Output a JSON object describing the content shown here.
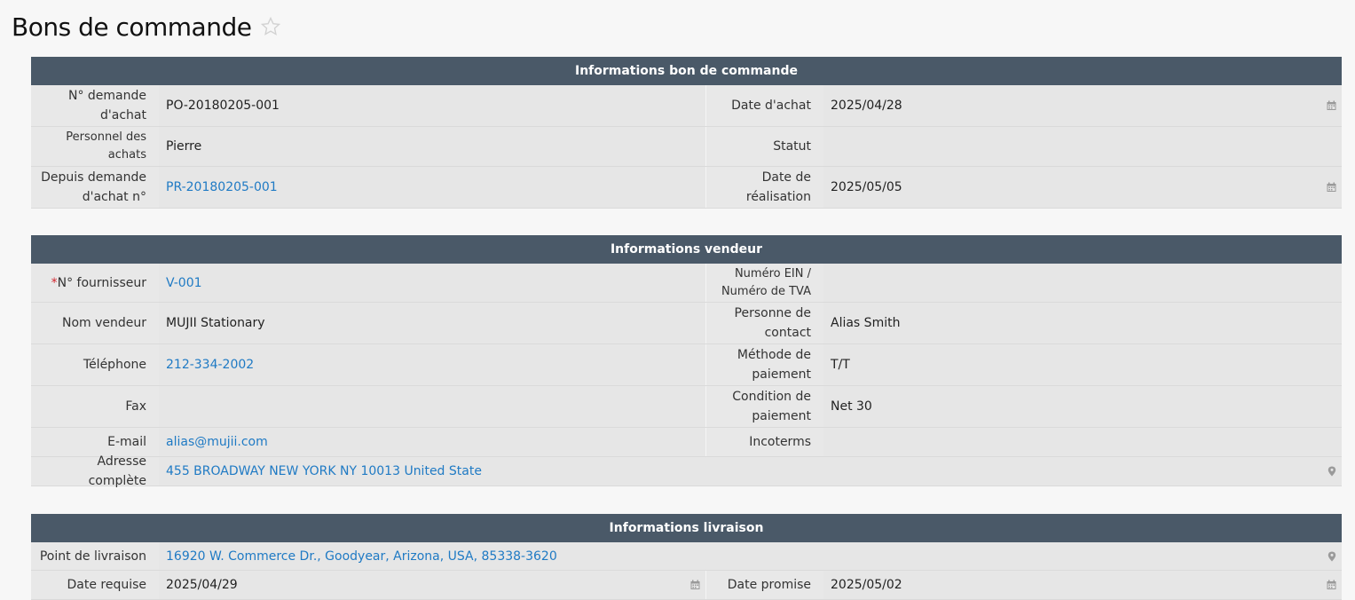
{
  "page": {
    "title": "Bons de commande"
  },
  "po_info": {
    "title": "Informations bon de commande",
    "po_number_label": "N° demande d'achat",
    "po_number": "PO-20180205-001",
    "purchase_date_label": "Date d'achat",
    "purchase_date": "2025/04/28",
    "buyer_label": "Personnel des achats",
    "buyer": "Pierre",
    "status_label": "Statut",
    "status": "",
    "from_pr_label": "Depuis demande d'achat n°",
    "from_pr": "PR-20180205-001",
    "completion_date_label": "Date de réalisation",
    "completion_date": "2025/05/05"
  },
  "vendor_info": {
    "title": "Informations vendeur",
    "supplier_no_required": "*",
    "supplier_no_label": "N° fournisseur",
    "supplier_no": "V-001",
    "ein_label": "Numéro EIN / Numéro de TVA",
    "ein": "",
    "vendor_name_label": "Nom vendeur",
    "vendor_name": "MUJII Stationary",
    "contact_label": "Personne de contact",
    "contact": "Alias Smith",
    "phone_label": "Téléphone",
    "phone": "212-334-2002",
    "payment_method_label": "Méthode de paiement",
    "payment_method": "T/T",
    "fax_label": "Fax",
    "fax": "",
    "payment_terms_label": "Condition de paiement",
    "payment_terms": "Net 30",
    "email_label": "E-mail",
    "email": "alias@mujii.com",
    "incoterms_label": "Incoterms",
    "incoterms": "",
    "address_label": "Adresse complète",
    "address": "455 BROADWAY NEW YORK NY 10013 United State"
  },
  "delivery_info": {
    "title": "Informations livraison",
    "delivery_point_label": "Point de livraison",
    "delivery_point": "16920 W. Commerce Dr., Goodyear, Arizona, USA, 85338-3620",
    "required_date_label": "Date requise",
    "required_date": "2025/04/29",
    "promised_date_label": "Date promise",
    "promised_date": "2025/05/02"
  },
  "icons": {
    "star": "star-outline-icon",
    "calendar": "calendar-icon",
    "location": "map-pin-icon"
  },
  "colors": {
    "section_header": "#4a5968",
    "link": "#1f7ac4",
    "required": "#d3262f"
  }
}
